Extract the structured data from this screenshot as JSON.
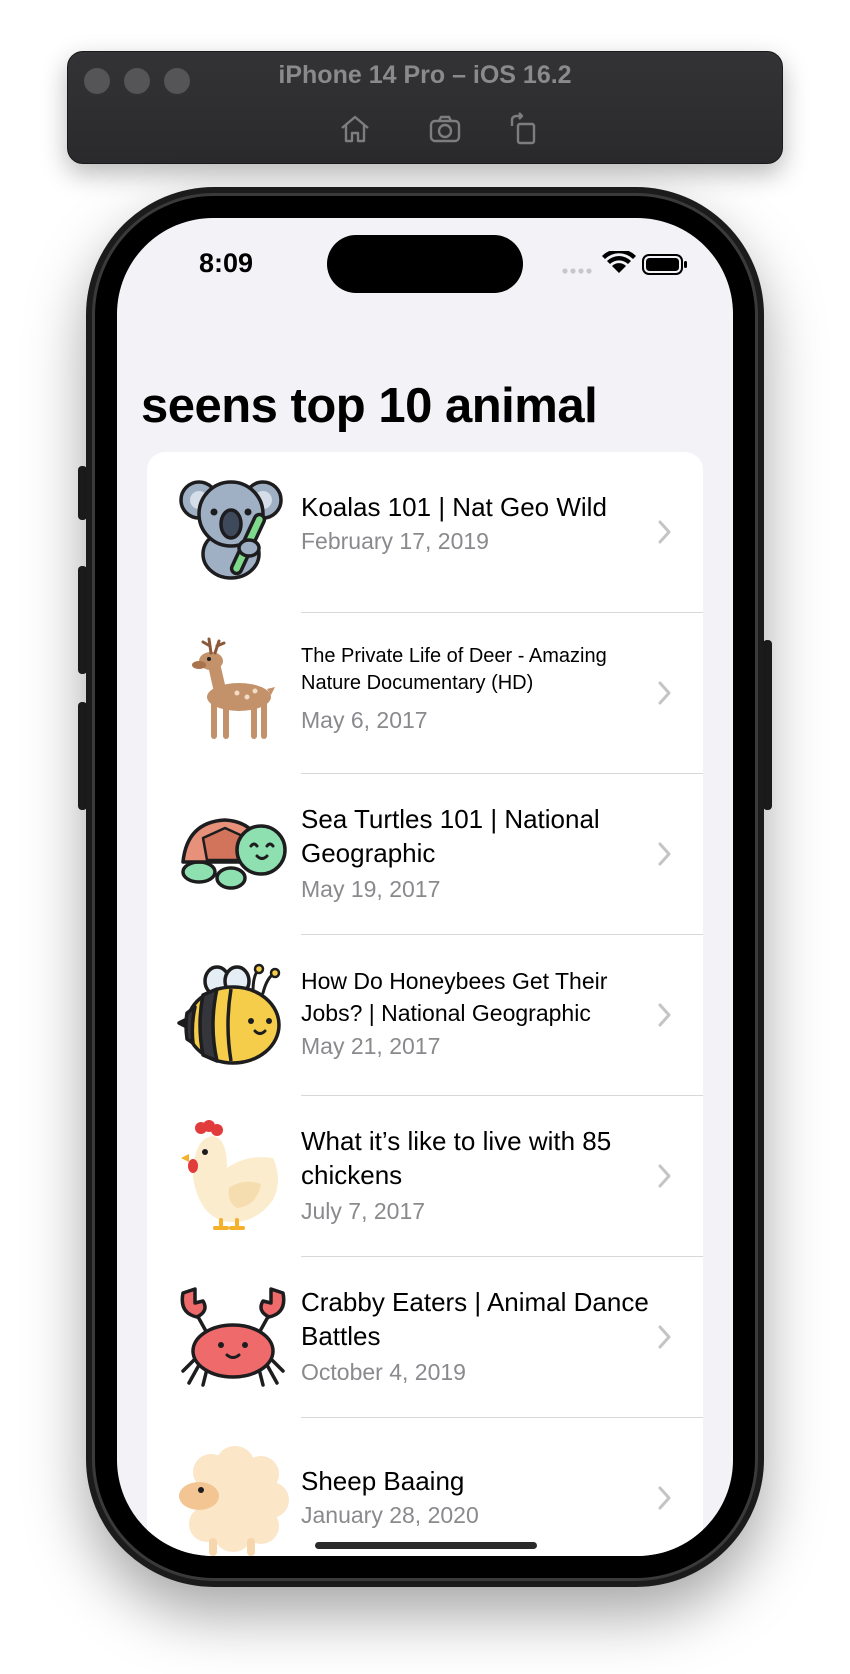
{
  "simulator": {
    "title": "iPhone 14 Pro – iOS 16.2",
    "tools": [
      "home-icon",
      "screenshot-icon",
      "rotate-icon"
    ]
  },
  "status_bar": {
    "time": "8:09",
    "icons": [
      "signal-icon",
      "wifi-icon",
      "battery-icon"
    ]
  },
  "nav": {
    "large_title": "seens top 10 animal"
  },
  "list": {
    "items": [
      {
        "title": "Koalas 101 | Nat Geo Wild",
        "date": "February 17, 2019",
        "icon": "koala-icon"
      },
      {
        "title": "The Private Life of Deer - Amazing Nature Documentary (HD)",
        "date": "May 6, 2017",
        "icon": "deer-icon"
      },
      {
        "title": "Sea Turtles 101 | National Geographic",
        "date": "May 19, 2017",
        "icon": "turtle-icon"
      },
      {
        "title": "How Do Honeybees Get Their Jobs? | National Geographic",
        "date": "May 21, 2017",
        "icon": "bee-icon"
      },
      {
        "title": "What it’s like to live with 85 chickens",
        "date": "July 7, 2017",
        "icon": "chicken-icon"
      },
      {
        "title": "Crabby Eaters | Animal Dance Battles",
        "date": "October 4, 2019",
        "icon": "crab-icon"
      },
      {
        "title": "Sheep Baaing",
        "date": "January 28, 2020",
        "icon": "sheep-icon"
      }
    ]
  },
  "colors": {
    "background": "#f2f2f7",
    "cell": "#ffffff",
    "secondary_text": "#8a8a8e",
    "chevron": "#c4c4c7"
  }
}
